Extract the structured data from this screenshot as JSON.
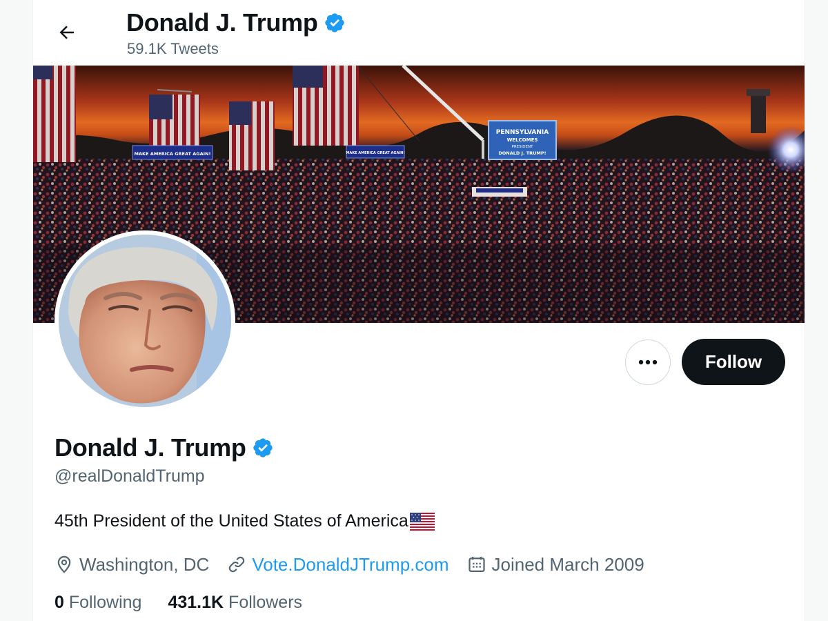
{
  "header": {
    "title": "Donald J. Trump",
    "tweet_count": "59.1K Tweets"
  },
  "banner": {
    "signs": [
      "MAKE AMERICA GREAT AGAIN!",
      "MAKE AMERICA GREAT AGAIN!"
    ],
    "screen_lines": [
      "PENNSYLVANIA",
      "WELCOMES",
      "PRESIDENT",
      "DONALD J. TRUMP!"
    ]
  },
  "actions": {
    "follow_label": "Follow"
  },
  "profile": {
    "name": "Donald J. Trump",
    "handle": "@realDonaldTrump",
    "bio": "45th President of the United States of America",
    "location": "Washington, DC",
    "website": "Vote.DonaldJTrump.com",
    "joined": "Joined March 2009",
    "following_count": "0",
    "following_label": "Following",
    "followers_count": "431.1K",
    "followers_label": "Followers"
  },
  "colors": {
    "accent": "#1d9bf0",
    "text": "#0f1419",
    "secondary": "#536471",
    "button": "#0f1419"
  },
  "icons": [
    "back-arrow-icon",
    "verified-badge-icon",
    "more-options-icon",
    "location-pin-icon",
    "link-icon",
    "calendar-icon",
    "us-flag-icon"
  ]
}
